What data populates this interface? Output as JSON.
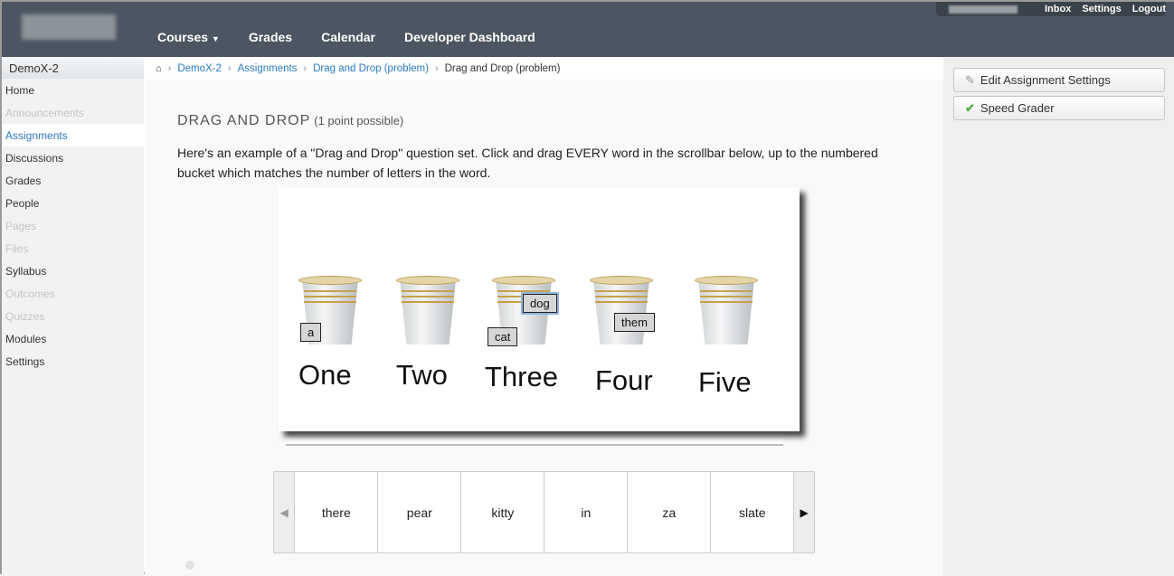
{
  "header": {
    "nav": [
      "Courses",
      "Grades",
      "Calendar",
      "Developer Dashboard"
    ],
    "user_nav": [
      "Inbox",
      "Settings",
      "Logout"
    ]
  },
  "sidebar": {
    "course": "DemoX-2",
    "items": [
      {
        "label": "Home",
        "state": "normal"
      },
      {
        "label": "Announcements",
        "state": "disabled"
      },
      {
        "label": "Assignments",
        "state": "active"
      },
      {
        "label": "Discussions",
        "state": "normal"
      },
      {
        "label": "Grades",
        "state": "normal"
      },
      {
        "label": "People",
        "state": "normal"
      },
      {
        "label": "Pages",
        "state": "disabled"
      },
      {
        "label": "Files",
        "state": "disabled"
      },
      {
        "label": "Syllabus",
        "state": "normal"
      },
      {
        "label": "Outcomes",
        "state": "disabled"
      },
      {
        "label": "Quizzes",
        "state": "disabled"
      },
      {
        "label": "Modules",
        "state": "normal"
      },
      {
        "label": "Settings",
        "state": "normal"
      }
    ]
  },
  "breadcrumb": [
    "DemoX-2",
    "Assignments",
    "Drag and Drop (problem)",
    "Drag and Drop (problem)"
  ],
  "main": {
    "title": "DRAG AND DROP",
    "points": "(1 point possible)",
    "description": "Here's an example of a \"Drag and Drop\" question set. Click and drag EVERY word in the scrollbar below, up to the numbered bucket which matches the number of letters in the word.",
    "buckets": [
      "One",
      "Two",
      "Three",
      "Four",
      "Five"
    ],
    "placed_words": [
      "a",
      "cat",
      "dog",
      "them"
    ],
    "scroller_words": [
      "there",
      "pear",
      "kitty",
      "in",
      "za",
      "slate"
    ]
  },
  "right": {
    "edit": "Edit Assignment Settings",
    "speed": "Speed Grader"
  },
  "colors": {
    "header": "#4c5662",
    "link": "#2b7abc"
  }
}
